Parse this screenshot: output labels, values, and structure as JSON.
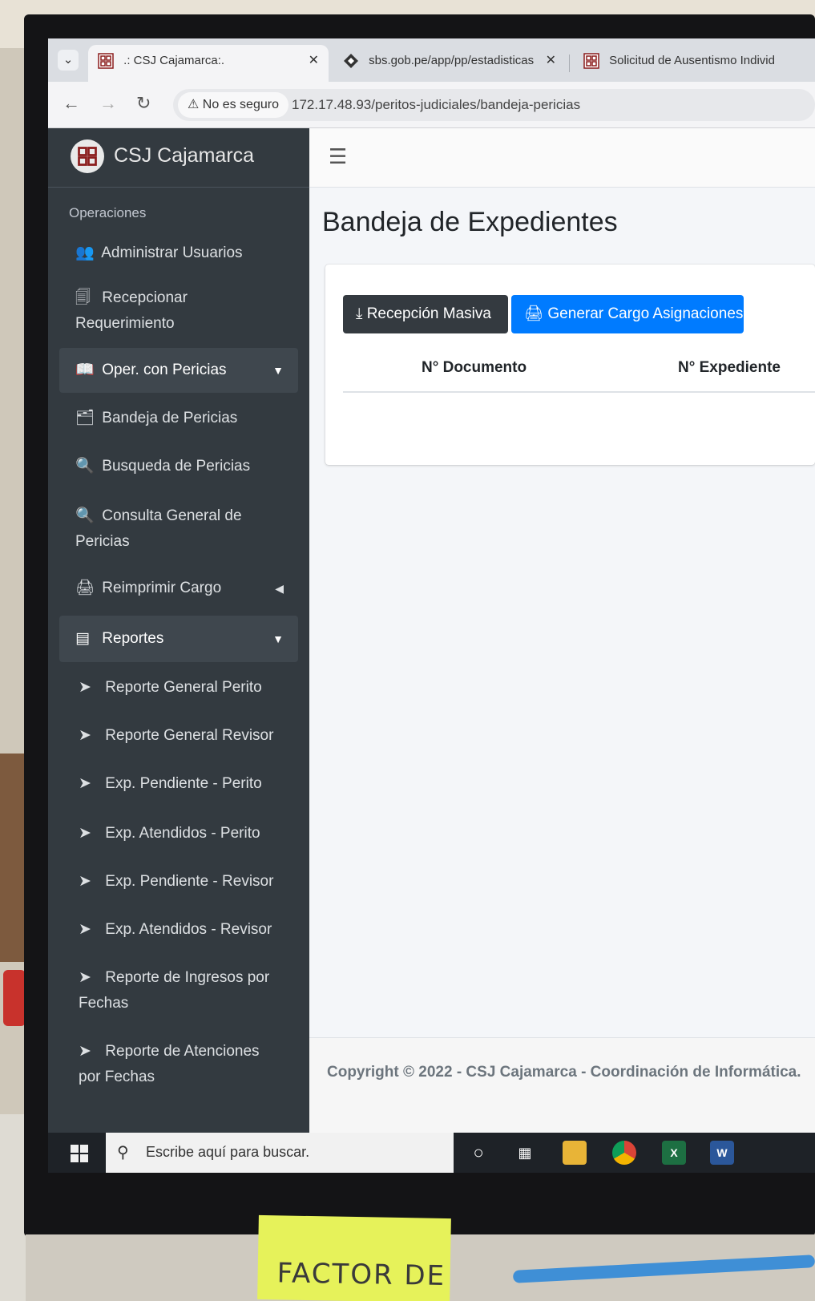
{
  "browser": {
    "tabs": [
      {
        "title": ".: CSJ Cajamarca:.",
        "active": true
      },
      {
        "title": "sbs.gob.pe/app/pp/estadisticas",
        "active": false
      },
      {
        "title": "Solicitud de Ausentismo Individ",
        "active": false
      }
    ],
    "security_label": "No es seguro",
    "url": "172.17.48.93/peritos-judiciales/bandeja-pericias"
  },
  "sidebar": {
    "brand": "CSJ Cajamarca",
    "section_title": "Operaciones",
    "items": [
      {
        "label": "Administrar Usuarios",
        "icon": "users-icon"
      },
      {
        "label": "Recepcionar Requerimiento",
        "icon": "document-icon"
      },
      {
        "label": "Oper. con Pericias",
        "icon": "book-icon"
      },
      {
        "label": "Bandeja de Pericias",
        "icon": "inbox-icon"
      },
      {
        "label": "Busqueda de Pericias",
        "icon": "search-icon"
      },
      {
        "label": "Consulta General de Pericias",
        "icon": "search-icon"
      },
      {
        "label": "Reimprimir Cargo",
        "icon": "printer-icon"
      },
      {
        "label": "Reportes",
        "icon": "list-icon"
      },
      {
        "label": "Reporte General Perito",
        "icon": "send-icon"
      },
      {
        "label": "Reporte General Revisor",
        "icon": "send-icon"
      },
      {
        "label": "Exp. Pendiente - Perito",
        "icon": "send-icon"
      },
      {
        "label": "Exp. Atendidos - Perito",
        "icon": "send-icon"
      },
      {
        "label": "Exp. Pendiente - Revisor",
        "icon": "send-icon"
      },
      {
        "label": "Exp. Atendidos - Revisor",
        "icon": "send-icon"
      },
      {
        "label": "Reporte de Ingresos por Fechas",
        "icon": "send-icon"
      },
      {
        "label": "Reporte de Atenciones por Fechas",
        "icon": "send-icon"
      }
    ]
  },
  "main": {
    "title": "Bandeja de Expedientes",
    "buttons": {
      "mass_reception": "Recepción Masiva",
      "generate_cargo": "Generar Cargo Asignaciones"
    },
    "table_headers": [
      "N° Documento",
      "N° Expediente"
    ]
  },
  "footer": {
    "copyright": "Copyright © 2022 - CSJ Cajamarca - Coordinación de Informática."
  },
  "taskbar": {
    "search_placeholder": "Escribe aquí para buscar."
  },
  "sticky_note": {
    "text": "FACTOR DE"
  },
  "colors": {
    "sidebar_bg": "#333a40",
    "primary": "#007bff",
    "dark_button": "#343a40"
  }
}
